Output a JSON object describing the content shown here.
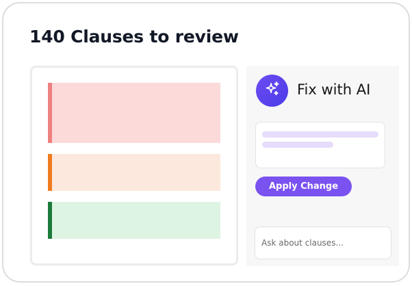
{
  "header": {
    "title": "140 Clauses to review"
  },
  "document": {
    "clauses": [
      {
        "severity": "high",
        "accent": "#ef8080",
        "fill": "#fcdada"
      },
      {
        "severity": "medium",
        "accent": "#f07b1e",
        "fill": "#fde8dd"
      },
      {
        "severity": "low",
        "accent": "#1c7a3a",
        "fill": "#def4e3"
      }
    ]
  },
  "ai_panel": {
    "title": "Fix with AI",
    "icon": "sparkles-icon",
    "apply_label": "Apply Change",
    "ask_placeholder": "Ask about clauses..."
  },
  "colors": {
    "primary": "#7a52f0",
    "avatar_gradient_start": "#6d4cf2",
    "avatar_gradient_end": "#4a3ce8",
    "skeleton": "#e6dcfb"
  }
}
